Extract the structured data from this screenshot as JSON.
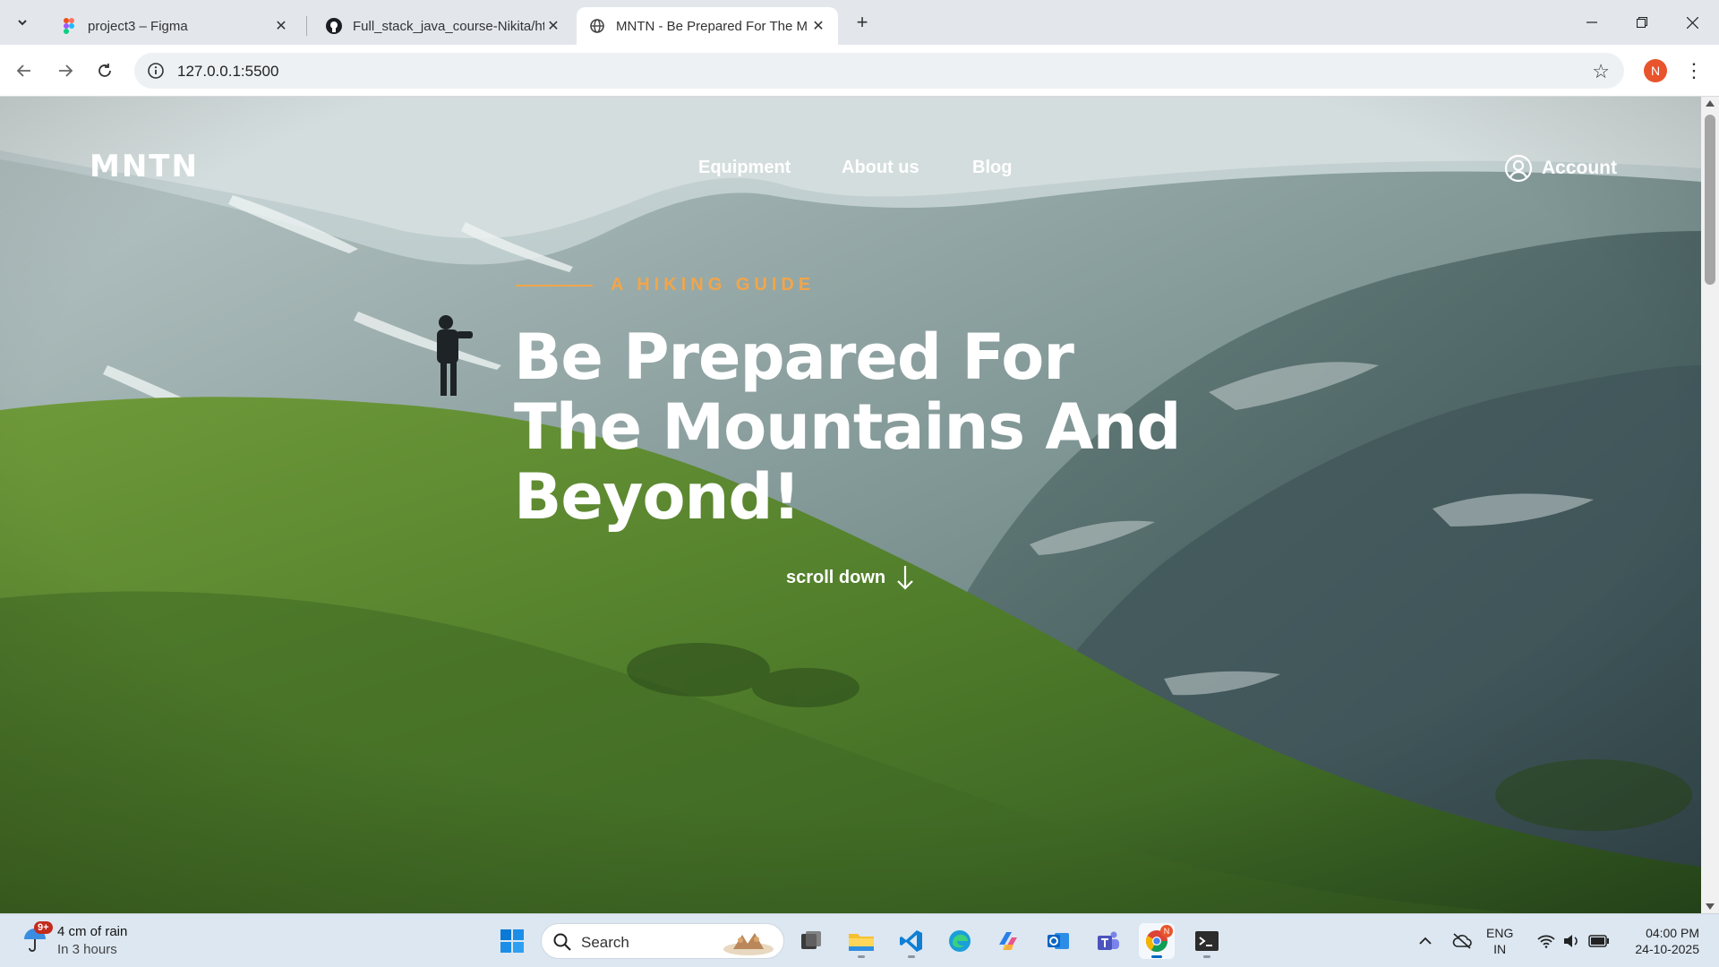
{
  "browser": {
    "tabs": [
      {
        "title": "project3 – Figma",
        "icon": "figma-icon"
      },
      {
        "title": "Full_stack_java_course-Nikita/ht",
        "icon": "github-icon"
      },
      {
        "title": "MNTN - Be Prepared For The M",
        "icon": "globe-icon",
        "active": true
      }
    ],
    "address": "127.0.0.1:5500",
    "profile_initial": "N",
    "colors": {
      "tabbar": "#e3e7ec",
      "profile": "#e8542b"
    }
  },
  "site": {
    "logo": "MNTN",
    "nav": [
      "Equipment",
      "About us",
      "Blog"
    ],
    "account_label": "Account",
    "kicker": "A HIKING GUIDE",
    "headline": [
      "Be Prepared For",
      "The Mountains And",
      "Beyond!"
    ],
    "scroll_label": "scroll down",
    "colors": {
      "accent": "#f2a54a",
      "text": "#ffffff"
    }
  },
  "taskbar": {
    "weather_main": "4 cm of rain",
    "weather_sub": "In 3 hours",
    "weather_badge": "9+",
    "search_placeholder": "Search",
    "pinned": [
      "windows-start-icon",
      "task-view-icon",
      "file-explorer-icon",
      "vscode-icon",
      "edge-icon",
      "copilot-icon",
      "outlook-icon",
      "teams-icon",
      "chrome-icon",
      "terminal-icon"
    ],
    "chrome_badge": "N",
    "lang_line1": "ENG",
    "lang_line2": "IN",
    "time": "04:00 PM",
    "date": "24-10-2025"
  }
}
